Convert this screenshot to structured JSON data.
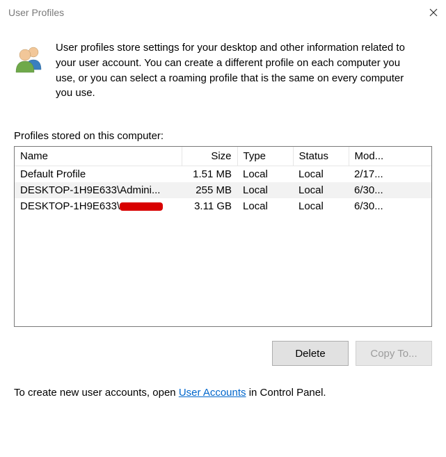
{
  "window": {
    "title": "User Profiles"
  },
  "intro": {
    "text": "User profiles store settings for your desktop and other information related to your user account. You can create a different profile on each computer you use, or you can select a roaming profile that is the same on every computer you use."
  },
  "section": {
    "label": "Profiles stored on this computer:"
  },
  "columns": {
    "name": "Name",
    "size": "Size",
    "type": "Type",
    "status": "Status",
    "modified": "Mod..."
  },
  "rows": [
    {
      "name_prefix": "Default Profile",
      "name_redacted": false,
      "size": "1.51 MB",
      "type": "Local",
      "status": "Local",
      "modified": "2/17...",
      "selected": false
    },
    {
      "name_prefix": "DESKTOP-1H9E633\\Admini...",
      "name_redacted": false,
      "size": "255 MB",
      "type": "Local",
      "status": "Local",
      "modified": "6/30...",
      "selected": true
    },
    {
      "name_prefix": "DESKTOP-1H9E633\\",
      "name_redacted": true,
      "size": "3.11 GB",
      "type": "Local",
      "status": "Local",
      "modified": "6/30...",
      "selected": false
    }
  ],
  "buttons": {
    "delete": "Delete",
    "copy_to": "Copy To...",
    "copy_to_disabled": true
  },
  "footnote": {
    "before": "To create new user accounts, open ",
    "link": "User Accounts",
    "after": " in Control Panel."
  }
}
